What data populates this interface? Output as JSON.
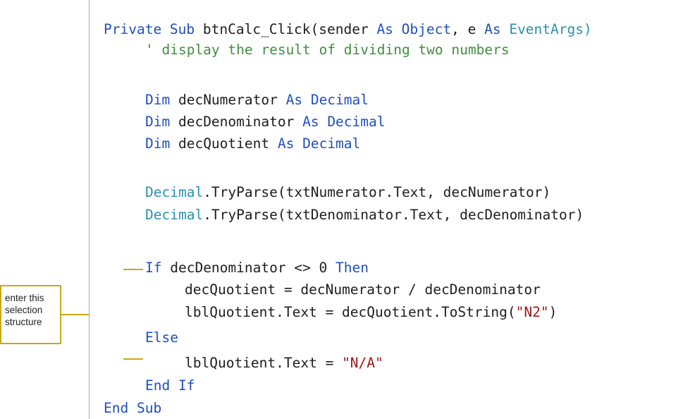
{
  "annotation": {
    "lines": [
      "enter this",
      "selection",
      "structure"
    ]
  },
  "code": {
    "line1": {
      "a": "Private Sub ",
      "b": "btnCalc_Click(sender ",
      "c": "As ",
      "d": "Object",
      "e": ", e ",
      "f": "As ",
      "g": "EventArgs)"
    },
    "line2": "' display the result of dividing two numbers",
    "line3": {
      "kw": "Dim ",
      "name": "decNumerator ",
      "as": "As ",
      "type": "Decimal"
    },
    "line4": {
      "kw": "Dim ",
      "name": "decDenominator ",
      "as": "As ",
      "type": "Decimal"
    },
    "line5": {
      "kw": "Dim ",
      "name": "decQuotient ",
      "as": "As ",
      "type": "Decimal"
    },
    "line6": {
      "type": "Decimal",
      "rest": ".TryParse(txtNumerator.Text, decNumerator)"
    },
    "line7": {
      "type": "Decimal",
      "rest": ".TryParse(txtDenominator.Text, decDenominator)"
    },
    "line8": {
      "kw": "If ",
      "mid": "decDenominator <> 0 ",
      "kw2": "Then"
    },
    "line9": "decQuotient = decNumerator / decDenominator",
    "line10": {
      "pre": "lblQuotient.Text = decQuotient.ToString(",
      "str": "\"N2\"",
      "post": ")"
    },
    "line11": "Else",
    "line12": {
      "pre": "lblQuotient.Text = ",
      "str": "\"N/A\""
    },
    "line13": "End If",
    "line14": "End Sub"
  }
}
